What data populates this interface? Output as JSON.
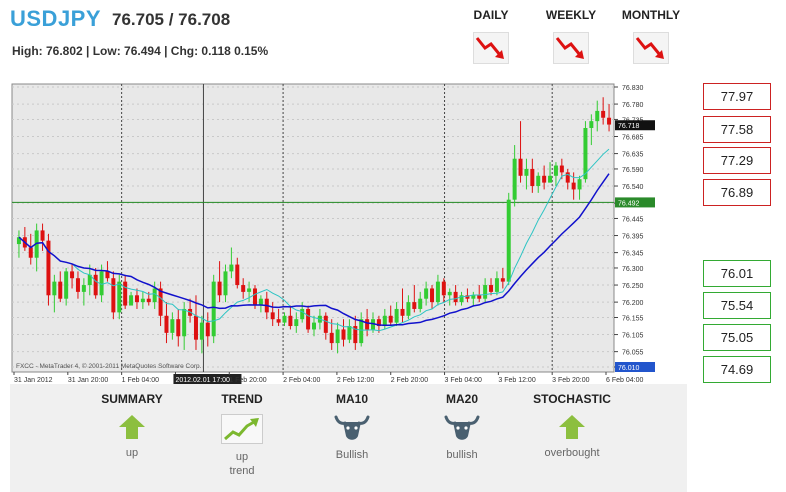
{
  "header": {
    "symbol": "USDJPY",
    "quote": "76.705 / 76.708",
    "stats": "High: 76.802 | Low: 76.494 | Chg: 0.118 0.15%"
  },
  "timeframes": [
    {
      "label": "DAILY",
      "trend": "down",
      "icon": "down-trend-arrow-icon",
      "color": "#dd1111"
    },
    {
      "label": "WEEKLY",
      "trend": "down",
      "icon": "down-trend-arrow-icon",
      "color": "#dd1111"
    },
    {
      "label": "MONTHLY",
      "trend": "down",
      "icon": "down-trend-arrow-icon",
      "color": "#dd1111"
    }
  ],
  "levels": {
    "resistance": [
      "77.97",
      "77.58",
      "77.29",
      "76.89"
    ],
    "support": [
      "76.01",
      "75.54",
      "75.05",
      "74.69"
    ],
    "resistance_color": "#cc2222",
    "support_color": "#33aa33"
  },
  "summary": [
    {
      "title": "SUMMARY",
      "value": "up",
      "value2": "",
      "icon": "up-arrow-icon"
    },
    {
      "title": "TREND",
      "value": "up",
      "value2": "trend",
      "icon": "uptrend-chart-icon"
    },
    {
      "title": "MA10",
      "value": "Bullish",
      "value2": "",
      "icon": "bull-icon"
    },
    {
      "title": "MA20",
      "value": "bullish",
      "value2": "",
      "icon": "bull-icon"
    },
    {
      "title": "STOCHASTIC",
      "value": "overbought",
      "value2": "",
      "icon": "up-arrow-icon"
    }
  ],
  "chart_data": {
    "type": "candlestick",
    "y_ticks": [
      "76.830",
      "76.780",
      "76.735",
      "76.685",
      "76.635",
      "76.590",
      "76.540",
      "76.490",
      "76.445",
      "76.395",
      "76.345",
      "76.300",
      "76.250",
      "76.200",
      "76.155",
      "76.105",
      "76.055",
      "76.010"
    ],
    "ylim": [
      76.01,
      76.83
    ],
    "x_ticks": [
      "31 Jan 2012",
      "31 Jan 20:00",
      "1 Feb 04:00",
      "2012.02.01 17:00",
      "1 Feb 20:00",
      "2 Feb 04:00",
      "2 Feb 12:00",
      "2 Feb 20:00",
      "3 Feb 04:00",
      "3 Feb 12:00",
      "3 Feb 20:00",
      "6 Feb 04:00"
    ],
    "current_price": "76.718",
    "hline_price": "76.492",
    "low_label": "76.010",
    "watermark": "FXCC - MetaTrader 4, © 2001-2011 MetaQuotes Software Corp.",
    "colors": {
      "bull": "#33cc33",
      "bear": "#dd1111",
      "ma10": "#2ec4c4",
      "ma20": "#1111cc",
      "hline": "#228822",
      "bg": "#e8e8e8"
    },
    "candles": [
      [
        76.37,
        76.41,
        76.33,
        76.39
      ],
      [
        76.39,
        76.42,
        76.35,
        76.36
      ],
      [
        76.36,
        76.4,
        76.31,
        76.33
      ],
      [
        76.33,
        76.43,
        76.29,
        76.41
      ],
      [
        76.41,
        76.43,
        76.35,
        76.38
      ],
      [
        76.38,
        76.4,
        76.19,
        76.22
      ],
      [
        76.22,
        76.28,
        76.17,
        76.26
      ],
      [
        76.26,
        76.29,
        76.2,
        76.21
      ],
      [
        76.21,
        76.3,
        76.19,
        76.29
      ],
      [
        76.29,
        76.31,
        76.24,
        76.27
      ],
      [
        76.27,
        76.29,
        76.21,
        76.23
      ],
      [
        76.23,
        76.27,
        76.19,
        76.25
      ],
      [
        76.25,
        76.31,
        76.22,
        76.28
      ],
      [
        76.28,
        76.3,
        76.21,
        76.22
      ],
      [
        76.22,
        76.31,
        76.2,
        76.29
      ],
      [
        76.29,
        76.32,
        76.26,
        76.27
      ],
      [
        76.27,
        76.29,
        76.15,
        76.17
      ],
      [
        76.17,
        76.28,
        76.15,
        76.26
      ],
      [
        76.26,
        76.28,
        76.18,
        76.19
      ],
      [
        76.19,
        76.23,
        76.2,
        76.22
      ],
      [
        76.22,
        76.24,
        76.18,
        76.2
      ],
      [
        76.2,
        76.23,
        76.18,
        76.21
      ],
      [
        76.21,
        76.23,
        76.19,
        76.2
      ],
      [
        76.2,
        76.26,
        76.18,
        76.24
      ],
      [
        76.24,
        76.26,
        76.13,
        76.16
      ],
      [
        76.16,
        76.2,
        76.08,
        76.11
      ],
      [
        76.11,
        76.17,
        76.09,
        76.15
      ],
      [
        76.15,
        76.18,
        76.07,
        76.1
      ],
      [
        76.1,
        76.2,
        76.06,
        76.18
      ],
      [
        76.18,
        76.21,
        76.14,
        76.16
      ],
      [
        76.16,
        76.22,
        76.06,
        76.09
      ],
      [
        76.09,
        76.16,
        76.05,
        76.14
      ],
      [
        76.14,
        76.17,
        76.07,
        76.1
      ],
      [
        76.1,
        76.28,
        76.08,
        76.26
      ],
      [
        76.26,
        76.32,
        76.2,
        76.22
      ],
      [
        76.22,
        76.31,
        76.2,
        76.29
      ],
      [
        76.29,
        76.36,
        76.27,
        76.31
      ],
      [
        76.31,
        76.33,
        76.24,
        76.25
      ],
      [
        76.25,
        76.27,
        76.21,
        76.23
      ],
      [
        76.23,
        76.26,
        76.2,
        76.24
      ],
      [
        76.24,
        76.25,
        76.18,
        76.19
      ],
      [
        76.19,
        76.22,
        76.17,
        76.21
      ],
      [
        76.21,
        76.23,
        76.15,
        76.17
      ],
      [
        76.17,
        76.2,
        76.13,
        76.15
      ],
      [
        76.15,
        76.18,
        76.13,
        76.14
      ],
      [
        76.14,
        76.17,
        76.13,
        76.16
      ],
      [
        76.16,
        76.19,
        76.12,
        76.13
      ],
      [
        76.13,
        76.17,
        76.11,
        76.15
      ],
      [
        76.15,
        76.2,
        76.14,
        76.18
      ],
      [
        76.18,
        76.19,
        76.11,
        76.12
      ],
      [
        76.12,
        76.16,
        76.1,
        76.14
      ],
      [
        76.14,
        76.18,
        76.12,
        76.16
      ],
      [
        76.16,
        76.17,
        76.09,
        76.11
      ],
      [
        76.11,
        76.15,
        76.06,
        76.08
      ],
      [
        76.08,
        76.14,
        76.05,
        76.12
      ],
      [
        76.12,
        76.15,
        76.07,
        76.09
      ],
      [
        76.09,
        76.15,
        76.08,
        76.13
      ],
      [
        76.13,
        76.16,
        76.06,
        76.08
      ],
      [
        76.08,
        76.17,
        76.07,
        76.15
      ],
      [
        76.15,
        76.18,
        76.1,
        76.12
      ],
      [
        76.12,
        76.17,
        76.11,
        76.15
      ],
      [
        76.15,
        76.16,
        76.11,
        76.13
      ],
      [
        76.13,
        76.18,
        76.12,
        76.16
      ],
      [
        76.16,
        76.19,
        76.13,
        76.14
      ],
      [
        76.14,
        76.2,
        76.13,
        76.18
      ],
      [
        76.18,
        76.24,
        76.14,
        76.16
      ],
      [
        76.16,
        76.22,
        76.15,
        76.2
      ],
      [
        76.2,
        76.25,
        76.17,
        76.18
      ],
      [
        76.18,
        76.23,
        76.17,
        76.21
      ],
      [
        76.21,
        76.26,
        76.19,
        76.24
      ],
      [
        76.24,
        76.25,
        76.18,
        76.2
      ],
      [
        76.2,
        76.28,
        76.19,
        76.26
      ],
      [
        76.26,
        76.27,
        76.2,
        76.22
      ],
      [
        76.22,
        76.24,
        76.19,
        76.23
      ],
      [
        76.23,
        76.25,
        76.19,
        76.2
      ],
      [
        76.2,
        76.23,
        76.19,
        76.22
      ],
      [
        76.22,
        76.24,
        76.2,
        76.21
      ],
      [
        76.21,
        76.23,
        76.19,
        76.22
      ],
      [
        76.22,
        76.25,
        76.2,
        76.21
      ],
      [
        76.21,
        76.27,
        76.2,
        76.25
      ],
      [
        76.25,
        76.27,
        76.22,
        76.23
      ],
      [
        76.23,
        76.29,
        76.22,
        76.27
      ],
      [
        76.27,
        76.3,
        76.24,
        76.26
      ],
      [
        76.26,
        76.52,
        76.25,
        76.5
      ],
      [
        76.5,
        76.66,
        76.48,
        76.62
      ],
      [
        76.62,
        76.73,
        76.55,
        76.57
      ],
      [
        76.57,
        76.62,
        76.53,
        76.59
      ],
      [
        76.59,
        76.62,
        76.52,
        76.54
      ],
      [
        76.54,
        76.58,
        76.52,
        76.57
      ],
      [
        76.57,
        76.6,
        76.53,
        76.55
      ],
      [
        76.55,
        76.61,
        76.55,
        76.57
      ],
      [
        76.57,
        76.61,
        76.54,
        76.6
      ],
      [
        76.6,
        76.62,
        76.56,
        76.58
      ],
      [
        76.58,
        76.59,
        76.53,
        76.55
      ],
      [
        76.55,
        76.58,
        76.5,
        76.53
      ],
      [
        76.53,
        76.57,
        76.5,
        76.56
      ],
      [
        76.56,
        76.73,
        76.55,
        76.71
      ],
      [
        76.71,
        76.75,
        76.66,
        76.73
      ],
      [
        76.73,
        76.79,
        76.7,
        76.76
      ],
      [
        76.76,
        76.8,
        76.72,
        76.74
      ],
      [
        76.74,
        76.78,
        76.7,
        76.72
      ]
    ]
  }
}
